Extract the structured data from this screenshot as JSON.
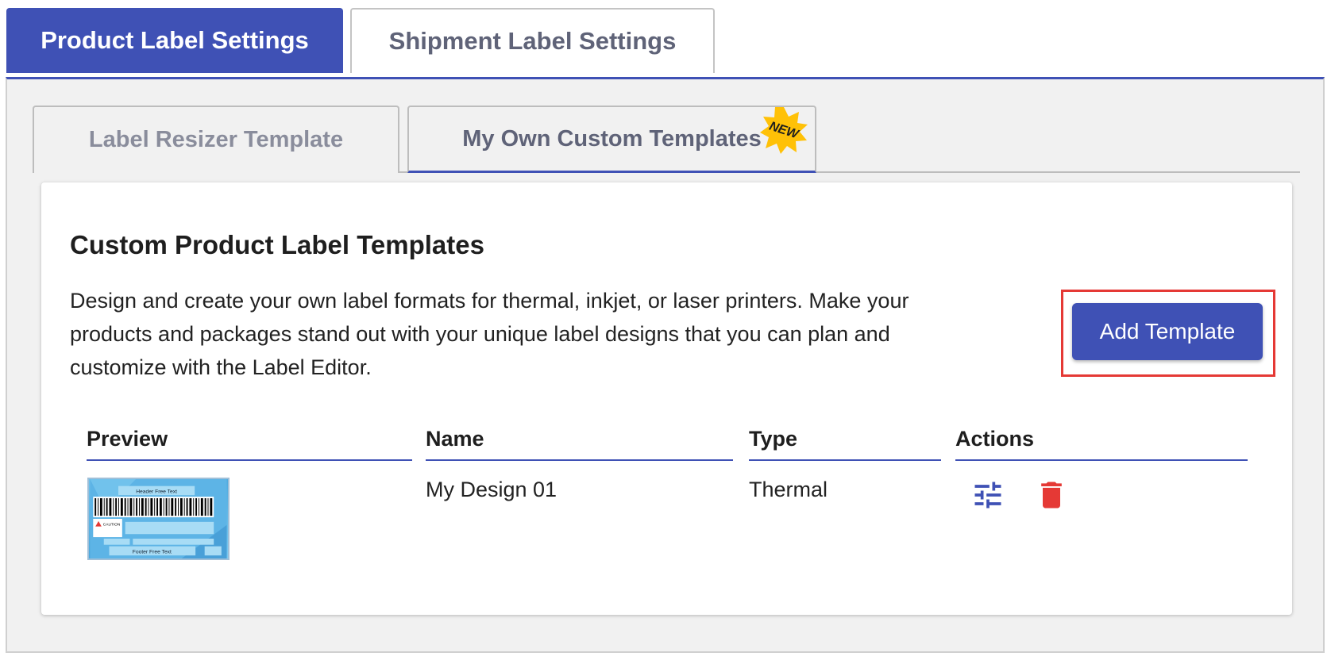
{
  "outer_tabs": {
    "product": "Product Label Settings",
    "shipment": "Shipment Label Settings"
  },
  "inner_tabs": {
    "resizer": "Label Resizer Template",
    "custom": "My Own Custom Templates",
    "new_badge": "NEW"
  },
  "card": {
    "title": "Custom Product Label Templates",
    "description": "Design and create your own label formats for thermal, inkjet, or laser printers. Make your products and packages stand out with your unique label designs that you can plan and customize with the Label Editor.",
    "add_button": "Add Template"
  },
  "table": {
    "headers": [
      "Preview",
      "Name",
      "Type",
      "Actions"
    ],
    "rows": [
      {
        "name": "My Design 01",
        "type": "Thermal"
      }
    ]
  },
  "preview_label": {
    "header": "Header Free Text",
    "footer": "Footer Free Text",
    "caution": "CAUTION"
  },
  "colors": {
    "accent": "#3f51b5",
    "danger": "#e53935",
    "badge": "#ffc107"
  },
  "icons": [
    "new-badge-icon",
    "tune-icon",
    "delete-icon"
  ]
}
